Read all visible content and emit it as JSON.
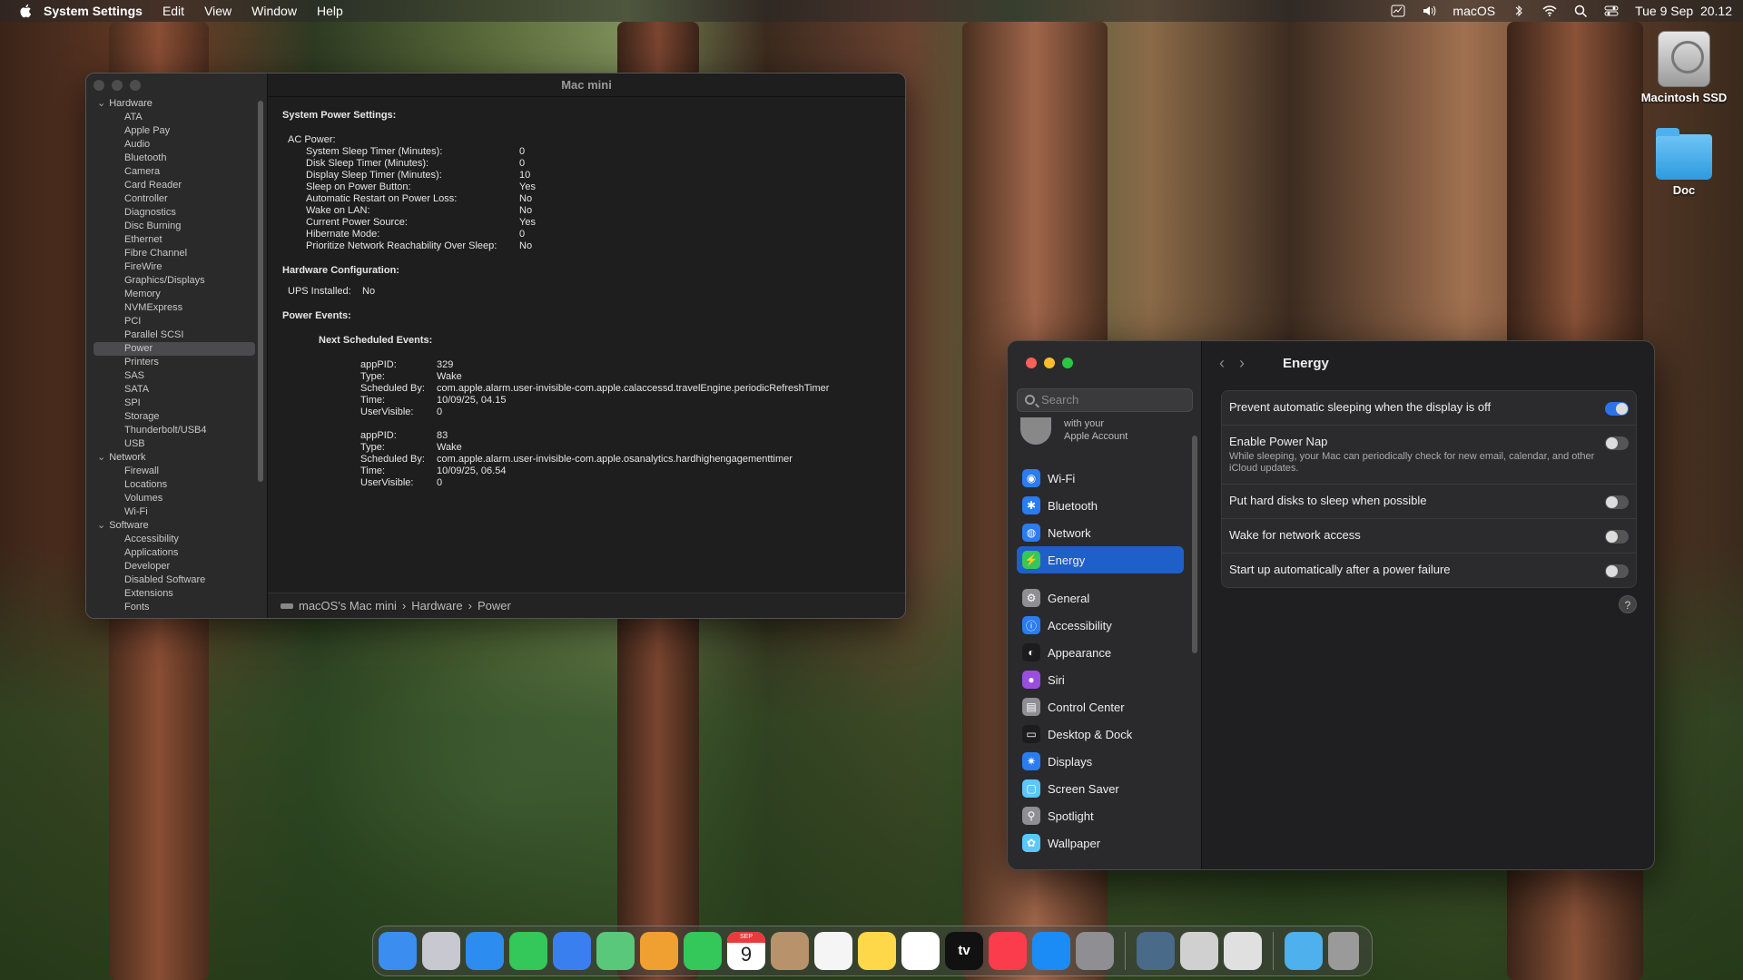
{
  "menubar": {
    "app": "System Settings",
    "items": [
      "Edit",
      "View",
      "Window",
      "Help"
    ],
    "user_label": "macOS",
    "datetime": "Tue 9 Sep  20.12"
  },
  "desktop": {
    "icons": [
      {
        "label": "Macintosh SSD",
        "icon": "hard-drive-icon"
      },
      {
        "label": "Doc",
        "icon": "folder-icon"
      }
    ]
  },
  "sysinfo": {
    "title": "Mac mini",
    "tree": [
      {
        "group": "Hardware",
        "items": [
          "ATA",
          "Apple Pay",
          "Audio",
          "Bluetooth",
          "Camera",
          "Card Reader",
          "Controller",
          "Diagnostics",
          "Disc Burning",
          "Ethernet",
          "Fibre Channel",
          "FireWire",
          "Graphics/Displays",
          "Memory",
          "NVMExpress",
          "PCI",
          "Parallel SCSI",
          "Power",
          "Printers",
          "SAS",
          "SATA",
          "SPI",
          "Storage",
          "Thunderbolt/USB4",
          "USB"
        ]
      },
      {
        "group": "Network",
        "items": [
          "Firewall",
          "Locations",
          "Volumes",
          "Wi-Fi"
        ]
      },
      {
        "group": "Software",
        "items": [
          "Accessibility",
          "Applications",
          "Developer",
          "Disabled Software",
          "Extensions",
          "Fonts"
        ]
      }
    ],
    "selected": "Power",
    "content": {
      "heading_system": "System Power Settings:",
      "ac_power": "AC Power:",
      "ac_rows": [
        [
          "System Sleep Timer (Minutes):",
          "0"
        ],
        [
          "Disk Sleep Timer (Minutes):",
          "0"
        ],
        [
          "Display Sleep Timer (Minutes):",
          "10"
        ],
        [
          "Sleep on Power Button:",
          "Yes"
        ],
        [
          "Automatic Restart on Power Loss:",
          "No"
        ],
        [
          "Wake on LAN:",
          "No"
        ],
        [
          "Current Power Source:",
          "Yes"
        ],
        [
          "Hibernate Mode:",
          "0"
        ],
        [
          "Prioritize Network Reachability Over Sleep:",
          "No"
        ]
      ],
      "heading_hw": "Hardware Configuration:",
      "ups": [
        "UPS Installed:",
        "No"
      ],
      "heading_events": "Power Events:",
      "next_events": "Next Scheduled Events:",
      "events": [
        [
          [
            "appPID:",
            "329"
          ],
          [
            "Type:",
            "Wake"
          ],
          [
            "Scheduled By:",
            "com.apple.alarm.user-invisible-com.apple.calaccessd.travelEngine.periodicRefreshTimer"
          ],
          [
            "Time:",
            "10/09/25, 04.15"
          ],
          [
            "UserVisible:",
            "0"
          ]
        ],
        [
          [
            "appPID:",
            "83"
          ],
          [
            "Type:",
            "Wake"
          ],
          [
            "Scheduled By:",
            "com.apple.alarm.user-invisible-com.apple.osanalytics.hardhighengagementtimer"
          ],
          [
            "Time:",
            "10/09/25, 06.54"
          ],
          [
            "UserVisible:",
            "0"
          ]
        ]
      ]
    },
    "breadcrumb": [
      "macOS's Mac mini",
      "Hardware",
      "Power"
    ]
  },
  "settings": {
    "search_placeholder": "Search",
    "account_line1": "with your",
    "account_line2": "Apple Account",
    "sidebar": [
      {
        "label": "Wi-Fi",
        "color": "#2a7cf0",
        "glyph": "◉"
      },
      {
        "label": "Bluetooth",
        "color": "#2a7cf0",
        "glyph": "✱"
      },
      {
        "label": "Network",
        "color": "#2a7cf0",
        "glyph": "◍"
      },
      {
        "label": "Energy",
        "color": "#34c759",
        "glyph": "⚡",
        "selected": true
      },
      {
        "label": "General",
        "color": "#8e8e93",
        "glyph": "⚙",
        "gap": true
      },
      {
        "label": "Accessibility",
        "color": "#2a7cf0",
        "glyph": "ⓘ"
      },
      {
        "label": "Appearance",
        "color": "#1c1c1e",
        "glyph": "◐"
      },
      {
        "label": "Siri",
        "color": "#9b4de0",
        "glyph": "●"
      },
      {
        "label": "Control Center",
        "color": "#8e8e93",
        "glyph": "▤"
      },
      {
        "label": "Desktop & Dock",
        "color": "#1c1c1e",
        "glyph": "▭"
      },
      {
        "label": "Displays",
        "color": "#2a7cf0",
        "glyph": "✷"
      },
      {
        "label": "Screen Saver",
        "color": "#5ac8fa",
        "glyph": "▢"
      },
      {
        "label": "Spotlight",
        "color": "#8e8e93",
        "glyph": "⚲"
      },
      {
        "label": "Wallpaper",
        "color": "#5ac8fa",
        "glyph": "✿"
      }
    ],
    "title": "Energy",
    "options": [
      {
        "label": "Prevent automatic sleeping when the display is off",
        "on": true
      },
      {
        "label": "Enable Power Nap",
        "desc": "While sleeping, your Mac can periodically check for new email, calendar, and other iCloud updates.",
        "on": false
      },
      {
        "label": "Put hard disks to sleep when possible",
        "on": false
      },
      {
        "label": "Wake for network access",
        "on": false
      },
      {
        "label": "Start up automatically after a power failure",
        "on": false
      }
    ],
    "help": "?"
  },
  "dock": {
    "calendar_month": "SEP",
    "calendar_day": "9",
    "appletv": "tv",
    "apps": [
      {
        "name": "finder-icon",
        "color": "#3b8ef0"
      },
      {
        "name": "launchpad-icon",
        "color": "#c8c8d0"
      },
      {
        "name": "safari-icon",
        "color": "#2d8cf0"
      },
      {
        "name": "messages-icon",
        "color": "#34c759"
      },
      {
        "name": "mail-icon",
        "color": "#3a7ff0"
      },
      {
        "name": "maps-icon",
        "color": "#5ac87a"
      },
      {
        "name": "photos-icon",
        "color": "#f0a030"
      },
      {
        "name": "facetime-icon",
        "color": "#34c759"
      },
      {
        "name": "calendar-icon",
        "color": "#ffffff"
      },
      {
        "name": "contacts-icon",
        "color": "#b8926a"
      },
      {
        "name": "reminders-icon",
        "color": "#f5f5f5"
      },
      {
        "name": "notes-icon",
        "color": "#ffd84a"
      },
      {
        "name": "freeform-icon",
        "color": "#ffffff"
      },
      {
        "name": "appletv-icon",
        "color": "#111111"
      },
      {
        "name": "music-icon",
        "color": "#fa3c4c"
      },
      {
        "name": "appstore-icon",
        "color": "#1b8cf5"
      },
      {
        "name": "system-settings-icon",
        "color": "#8e8e93"
      },
      {
        "name": "system-information-icon",
        "color": "#4a6a8a"
      },
      {
        "name": "script-editor-icon",
        "color": "#d0d0d0"
      },
      {
        "name": "preview-icon",
        "color": "#e0e0e0"
      },
      {
        "name": "downloads-folder-icon",
        "color": "#4eb0ec"
      },
      {
        "name": "trash-icon",
        "color": "#9a9a9a"
      }
    ]
  }
}
